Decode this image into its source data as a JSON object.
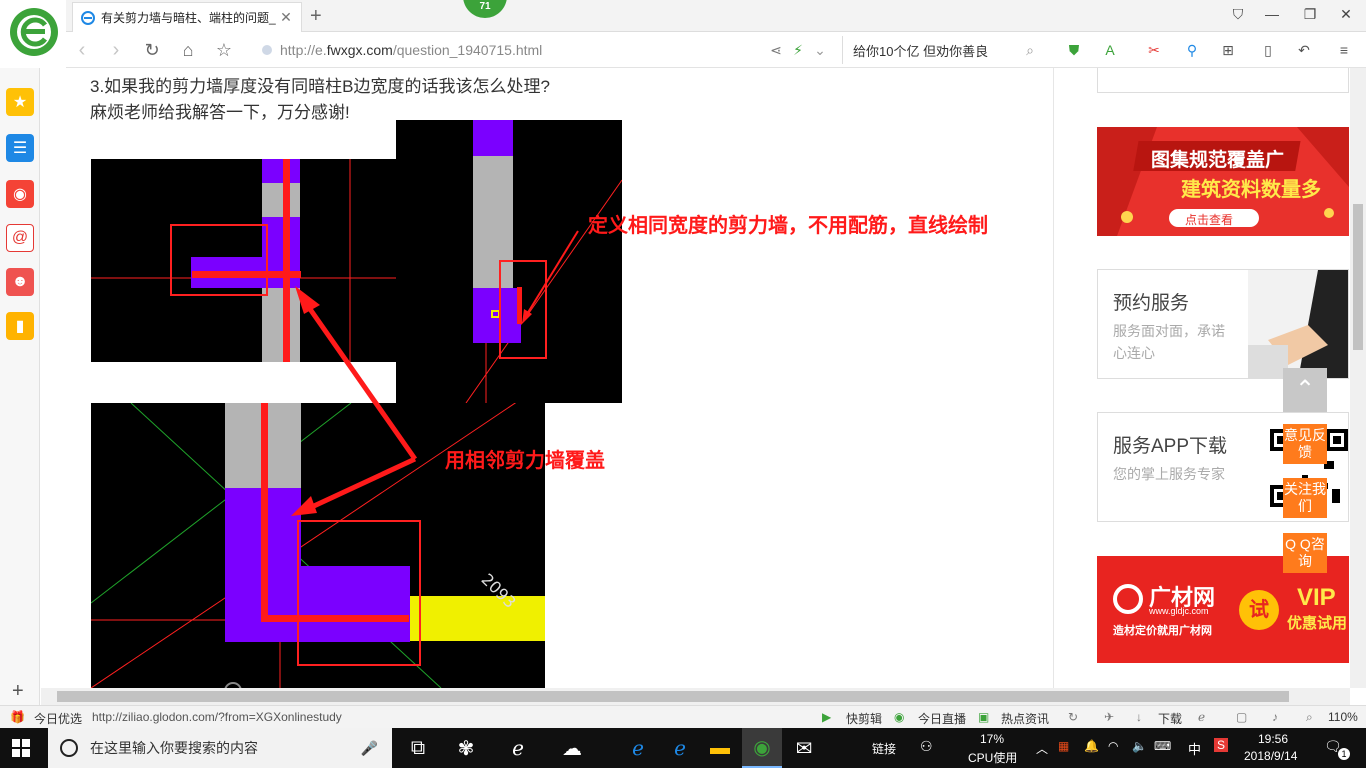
{
  "browser": {
    "tab": {
      "title": "有关剪力墙与暗柱、端柱的问题_"
    },
    "badge": "71",
    "url": {
      "prefix": "http://e.",
      "domain": "fwxgx.com",
      "path": "/question_1940715.html"
    },
    "search": {
      "text": "给你10个亿 但劝你善良"
    },
    "new_tab": "+"
  },
  "question": {
    "line1": "3.如果我的剪力墙厚度没有同暗柱B边宽度的话我该怎么处理?",
    "line2": "麻烦老师给我解答一下，万分感谢!"
  },
  "annotations": {
    "note1": "定义相同宽度的剪力墙，不用配筋，直线绘制",
    "note2": "用相邻剪力墙覆盖",
    "dimension": "2093",
    "marker": "C"
  },
  "sidebar_right": {
    "ad1": {
      "line1": "图集规范覆盖广",
      "line2": "建筑资料数量多",
      "cta": "点击查看"
    },
    "booking": {
      "title": "预约服务",
      "desc": "服务面对面，承诺心连心"
    },
    "app": {
      "title": "服务APP下载",
      "desc": "您的掌上服务专家"
    },
    "ad2": {
      "brand": "广材网",
      "site": "www.gldjc.com",
      "slogan": "造材定价就用广材网",
      "trial": "试",
      "vip": "VIP",
      "vip_sub": "优惠试用"
    },
    "float": {
      "feedback": "意见反馈",
      "follow": "关注我们",
      "qq": "Q Q咨询"
    }
  },
  "statusbar": {
    "today_pick": "今日优选",
    "link": "http://ziliao.glodon.com/?from=XGXonlinestudy",
    "quick_cut": "快剪辑",
    "live": "今日直播",
    "news": "热点资讯",
    "download": "下载",
    "zoom": "110%"
  },
  "taskbar": {
    "search_placeholder": "在这里输入你要搜索的内容",
    "link_label": "链接",
    "cpu_percent": "17%",
    "cpu_label": "CPU使用",
    "ime": "中",
    "time": "19:56",
    "date": "2018/9/14",
    "notifications": "1"
  },
  "colors": {
    "accent_green": "#3ca33a",
    "annotation_red": "#ff1a1a",
    "wall_purple": "#7b00ff",
    "wall_gray": "#b4b4b4",
    "beam_yellow": "#f0f000",
    "float_orange": "#ff7b1c"
  }
}
